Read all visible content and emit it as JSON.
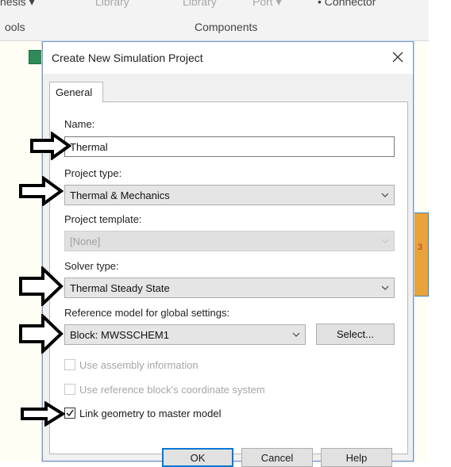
{
  "ribbon": {
    "top_items": [
      "nesis ▾",
      "Library",
      "Library",
      "Port ▾",
      "• Connector"
    ],
    "tools_label": "ools",
    "components_label": "Components"
  },
  "canvas": {
    "block_number": "3"
  },
  "dialog": {
    "title": "Create New Simulation Project",
    "tab_general": "General",
    "name_label": "Name:",
    "name_value": "Thermal",
    "project_type_label": "Project type:",
    "project_type_value": "Thermal & Mechanics",
    "project_template_label": "Project template:",
    "project_template_value": "[None]",
    "solver_type_label": "Solver type:",
    "solver_type_value": "Thermal Steady State",
    "reference_label": "Reference model for global settings:",
    "reference_value": "Block: MWSSCHEM1",
    "select_button": "Select...",
    "use_assembly_label": "Use assembly information",
    "use_assembly_checked": false,
    "use_reference_block_label": "Use reference block's coordinate system",
    "use_reference_block_checked": false,
    "link_geometry_label": "Link geometry to master model",
    "link_geometry_checked": true,
    "ok_button": "OK",
    "cancel_button": "Cancel",
    "help_button": "Help"
  },
  "colors": {
    "accent": "#0078d7",
    "dialog_border": "#7a9ac8",
    "arrow": "#000000",
    "canvas_block": "#e8a33b"
  },
  "icons": [
    "close-icon",
    "chevron-down-icon",
    "checkmark-icon",
    "arrow-right-icon"
  ]
}
